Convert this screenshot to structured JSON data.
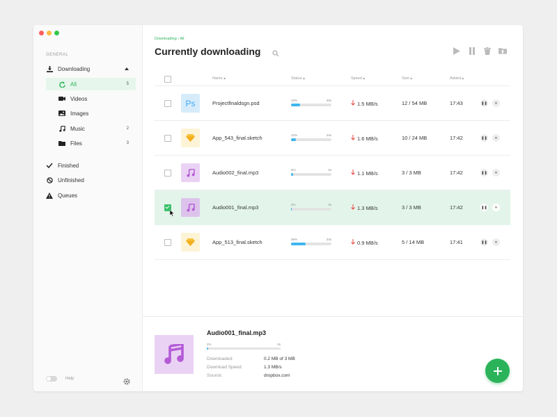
{
  "window": {
    "colors": {
      "close": "#fc605c",
      "minimize": "#fdbc40",
      "zoom": "#34c84a"
    }
  },
  "sidebar": {
    "section_label": "GENERAL",
    "downloading": {
      "label": "Downloading",
      "icon": "download-icon"
    },
    "sub_items": [
      {
        "label": "All",
        "count": "5",
        "icon": "refresh-icon",
        "active": true
      },
      {
        "label": "Videos",
        "count": "",
        "icon": "video-icon"
      },
      {
        "label": "Images",
        "count": "",
        "icon": "image-icon"
      },
      {
        "label": "Music",
        "count": "2",
        "icon": "music-icon"
      },
      {
        "label": "Files",
        "count": "3",
        "icon": "folder-icon"
      }
    ],
    "items": [
      {
        "label": "Finished",
        "icon": "check-icon"
      },
      {
        "label": "Unfinished",
        "icon": "cancel-icon"
      },
      {
        "label": "Queues",
        "icon": "warning-icon"
      }
    ],
    "help_label": "Help"
  },
  "main": {
    "breadcrumb": "Downloading › All",
    "title": "Currently downloading",
    "columns": {
      "name": "Name ▴",
      "status": "Status ▴",
      "speed": "Speed ▴",
      "size": "Size ▴",
      "added": "Added ▴"
    },
    "rows": [
      {
        "name": "Projectfinaldsgn.psd",
        "percent": "22%",
        "progress": 0.22,
        "remaining": "40s",
        "speed": "1.5 MB/s",
        "size": "12 / 54 MB",
        "added": "17:43",
        "type": "psd",
        "checked": false,
        "selected": false
      },
      {
        "name": "App_543_final.sketch",
        "percent": "12%",
        "progress": 0.12,
        "remaining": "24s",
        "speed": "1.6 MB/s",
        "size": "10 / 24 MB",
        "added": "17:42",
        "type": "sketch",
        "checked": false,
        "selected": false
      },
      {
        "name": "Audio002_final.mp3",
        "percent": "6%",
        "progress": 0.06,
        "remaining": "2s",
        "speed": "1.1 MB/s",
        "size": "3 / 3 MB",
        "added": "17:42",
        "type": "audio",
        "checked": false,
        "selected": false
      },
      {
        "name": "Audio001_final.mp3",
        "percent": "2%",
        "progress": 0.02,
        "remaining": "3s",
        "speed": "1.3 MB/s",
        "size": "3 / 3 MB",
        "added": "17:42",
        "type": "audio",
        "checked": true,
        "selected": true
      },
      {
        "name": "App_513_final.sketch",
        "percent": "36%",
        "progress": 0.36,
        "remaining": "24s",
        "speed": "0.9 MB/s",
        "size": "5 / 14 MB",
        "added": "17:41",
        "type": "sketch",
        "checked": false,
        "selected": false
      }
    ]
  },
  "details": {
    "title": "Audio001_final.mp3",
    "percent": "2%",
    "progress": 0.02,
    "remaining": "3s",
    "downloaded_label": "Downloaded:",
    "downloaded_value": "0.2 MB of 3 MB",
    "speed_label": "Download Speed:",
    "speed_value": "1.3 MB/s",
    "source_label": "Source:",
    "source_value": "dropbox.com"
  },
  "colors": {
    "accent": "#2bb35a",
    "progress": "#3fb6ef",
    "speed_arrow": "#e8453c",
    "selected_row": "#e3f5ea"
  }
}
